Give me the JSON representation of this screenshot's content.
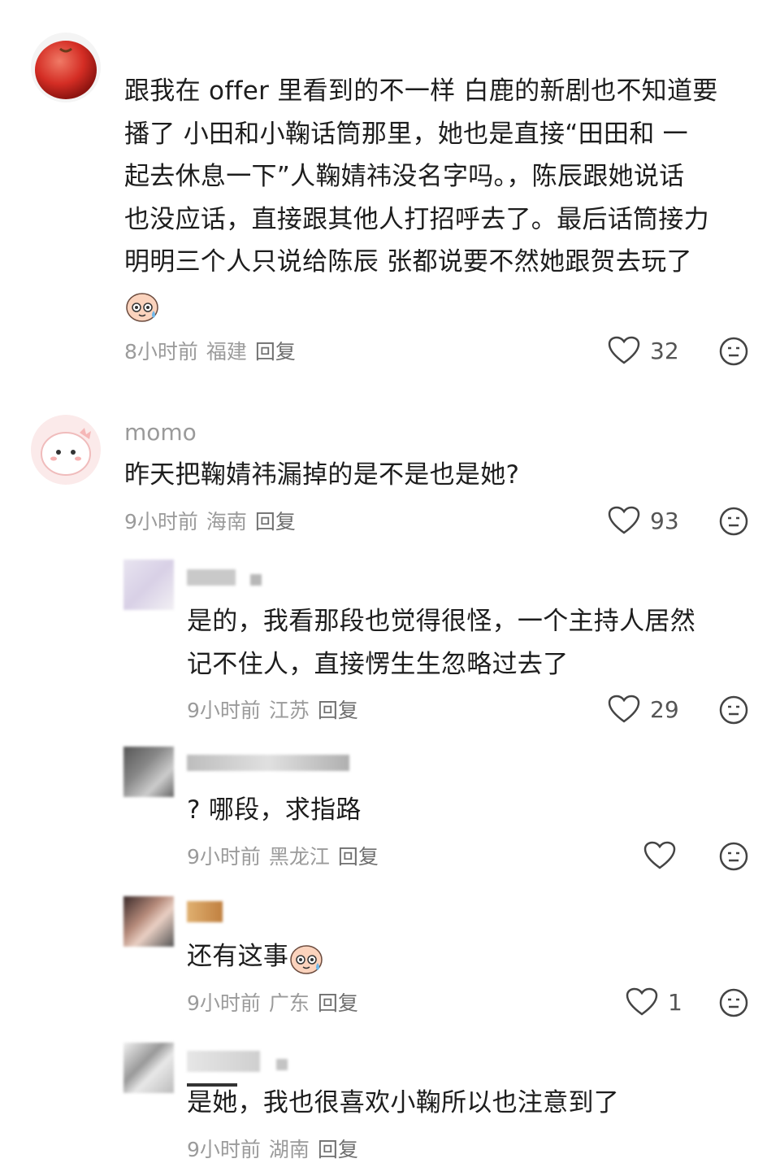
{
  "comments": [
    {
      "username": "",
      "lines": [
        "跟我在 offer 里看到的不一样 白鹿的新剧也不知道要",
        "播了 小田和小鞠话筒那里，她也是直接“田田和  一",
        "起去休息一下”人鞠婧祎没名字吗。，陈辰跟她说话",
        "也没应话，直接跟其他人打招呼去了。最后话筒接力",
        "明明三个人只说给陈辰 张都说要不然她跟贺去玩了"
      ],
      "emoji": "sweat-face-emoji",
      "time": "8小时前",
      "location": "福建",
      "reply": "回复",
      "likes": "32",
      "avatar": "apple-avatar"
    },
    {
      "username": "momo",
      "lines": [
        "昨天把鞠婧祎漏掉的是不是也是她?"
      ],
      "time": "9小时前",
      "location": "海南",
      "reply": "回复",
      "likes": "93",
      "avatar": "pink-dino-avatar"
    },
    {
      "username": "",
      "lines": [
        "是的，我看那段也觉得很怪，一个主持人居然",
        "记不住人，直接愣生生忽略过去了"
      ],
      "time": "9小时前",
      "location": "江苏",
      "reply": "回复",
      "likes": "29"
    },
    {
      "username": "",
      "lines": [
        "? 哪段，求指路"
      ],
      "time": "9小时前",
      "location": "黑龙江",
      "reply": "回复",
      "likes": ""
    },
    {
      "username": "",
      "lines": [
        "还有这事"
      ],
      "emoji": "sweat-face-emoji",
      "time": "9小时前",
      "location": "广东",
      "reply": "回复",
      "likes": "1"
    },
    {
      "username": "",
      "lines": [
        "是她，我也很喜欢小鞠所以也注意到了"
      ],
      "time": "9小时前",
      "location": "湖南",
      "reply": "回复",
      "likes": ""
    }
  ],
  "colors": {
    "text": "#1d1d1d",
    "meta": "#9b9b9b",
    "icon": "#444444"
  }
}
